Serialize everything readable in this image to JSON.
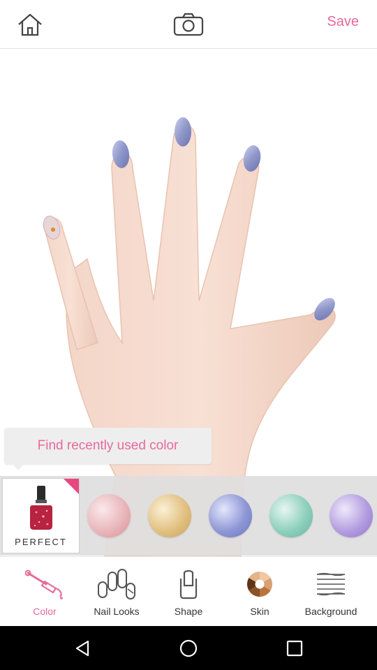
{
  "topbar": {
    "home_icon": "home-icon",
    "camera_icon": "camera-icon",
    "save_label": "Save",
    "accent_color": "#e76a98"
  },
  "canvas": {
    "nail_color": "#8f96c8"
  },
  "tooltip": {
    "text": "Find recently used color"
  },
  "color_strip": {
    "featured_label": "PERFECT",
    "swatches": [
      {
        "name": "rose",
        "color": "#e9b7bb"
      },
      {
        "name": "gold",
        "color": "#e2c182"
      },
      {
        "name": "periwinkle",
        "color": "#8f98d6"
      },
      {
        "name": "mint",
        "color": "#8fd0bd"
      },
      {
        "name": "lavender",
        "color": "#b49ee0"
      }
    ]
  },
  "tabs": [
    {
      "label": "Color",
      "icon": "nail-brush-icon",
      "active": true
    },
    {
      "label": "Nail Looks",
      "icon": "nail-looks-icon",
      "active": false
    },
    {
      "label": "Shape",
      "icon": "nail-shape-icon",
      "active": false
    },
    {
      "label": "Skin",
      "icon": "skin-tone-wheel-icon",
      "active": false
    },
    {
      "label": "Background",
      "icon": "background-pattern-icon",
      "active": false
    }
  ],
  "navbar": {
    "back_icon": "back-icon",
    "home_icon": "home-circle-icon",
    "recents_icon": "recents-icon"
  }
}
